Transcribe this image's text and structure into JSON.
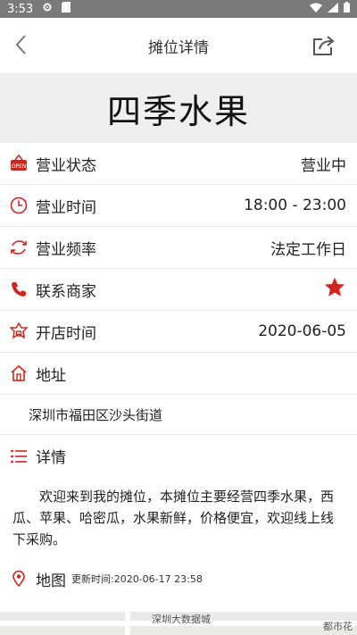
{
  "status_bar": {
    "time": "3:53"
  },
  "header": {
    "title": "摊位详情"
  },
  "stall": {
    "name": "四季水果"
  },
  "rows": [
    {
      "key": "status",
      "label": "营业状态",
      "value": "营业中"
    },
    {
      "key": "hours",
      "label": "营业时间",
      "value": "18:00 - 23:00"
    },
    {
      "key": "frequency",
      "label": "营业频率",
      "value": "法定工作日"
    },
    {
      "key": "contact",
      "label": "联系商家",
      "value": ""
    },
    {
      "key": "opened",
      "label": "开店时间",
      "value": "2020-06-05"
    },
    {
      "key": "address",
      "label": "地址",
      "value": ""
    }
  ],
  "address_text": "深圳市福田区沙头街道",
  "detail": {
    "label": "详情",
    "text": "欢迎来到我的摊位，本摊位主要经营四季水果，西瓜、苹果、哈密瓜，水果新鲜，价格便宜，欢迎线上线下采购。"
  },
  "map": {
    "label": "地图",
    "updated": "更新时间:2020-06-17 23:58",
    "place_1": "深圳大数据城",
    "place_2": "都市花"
  },
  "colors": {
    "accent": "#d0261d",
    "status_bar": "#7a7a7a",
    "hero_bg": "#efefef"
  },
  "icons": {
    "status": "open-sign-icon",
    "hours": "clock-icon",
    "frequency": "cycle-icon",
    "contact": "phone-icon",
    "opened": "shop-icon",
    "address": "house-icon",
    "detail": "list-icon",
    "map": "location-pin-icon",
    "favorite": "star-icon",
    "share": "share-icon",
    "back": "back-arrow-icon"
  }
}
